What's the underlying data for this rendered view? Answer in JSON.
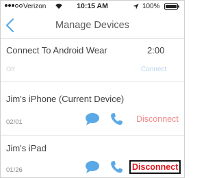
{
  "status_bar": {
    "carrier": "Verizon",
    "time": "10:15 AM",
    "battery": "100%"
  },
  "nav": {
    "title": "Manage Devices"
  },
  "android_wear": {
    "title": "Connect To Android Wear",
    "timer": "2:00",
    "status": "Off",
    "action": "Connect"
  },
  "devices": [
    {
      "name": "Jim's iPhone (Current Device)",
      "date": "02/01",
      "action": "Disconnect"
    },
    {
      "name": "Jim's iPad",
      "date": "01/26",
      "action": "Disconnect"
    }
  ],
  "colors": {
    "accent_blue": "#5aa9e6",
    "disconnect_red": "#ef8a8a",
    "disconnect_highlight_red": "#e0131b"
  }
}
